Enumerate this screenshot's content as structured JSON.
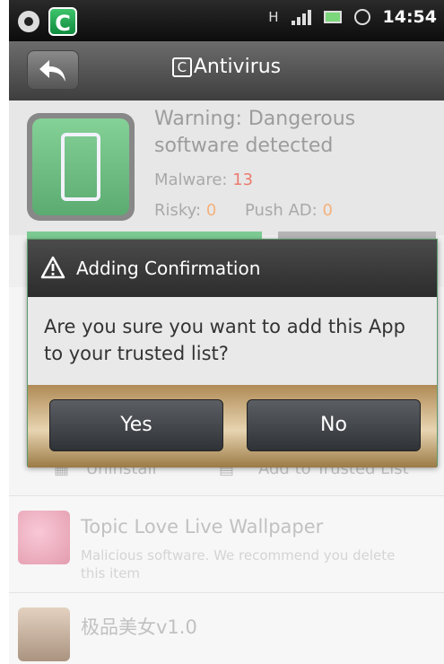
{
  "status_bar": {
    "time": "14:54",
    "network_letter": "H",
    "notification_icons": [
      "settings-icon",
      "antivirus-app-icon"
    ]
  },
  "header": {
    "title": "Antivirus",
    "title_logo": "C",
    "back_icon": "back-arrow-icon"
  },
  "warning": {
    "message": "Warning: Dangerous software detected",
    "malware_label": "Malware:",
    "malware_count": "13",
    "risky_label": "Risky:",
    "risky_count": "0",
    "pushad_label": "Push AD:",
    "pushad_count": "0"
  },
  "actions": {
    "uninstall_label": "Uninstall",
    "trusted_label": "Add to Trusted List"
  },
  "items": [
    {
      "name": "Topic Love Live Wallpaper",
      "description": "Malicious software. We recommend you delete this item"
    },
    {
      "name": "极品美女v1.0",
      "description": ""
    }
  ],
  "dialog": {
    "title": "Adding Confirmation",
    "message": "Are you sure you want to add this App to your trusted list?",
    "yes_label": "Yes",
    "no_label": "No"
  },
  "colors": {
    "accent_green": "#2e9e4f",
    "malware_red": "#e34a3a",
    "count_orange": "#f0944a"
  }
}
